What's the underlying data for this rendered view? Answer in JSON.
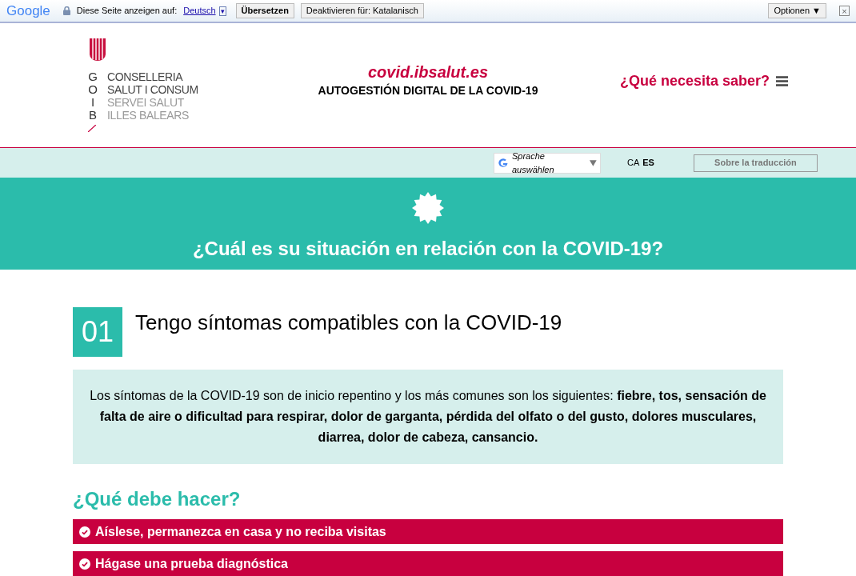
{
  "translate_bar": {
    "brand": "Google",
    "prompt": "Diese Seite anzeigen auf:",
    "language": "Deutsch",
    "dropdown_glyph": "▾",
    "translate_button": "Übersetzen",
    "disable_button": "Deaktivieren für: Katalanisch",
    "options_button": "Optionen ▼",
    "close_glyph": "×"
  },
  "header": {
    "logo_letters": [
      "G",
      "O",
      "I",
      "B"
    ],
    "logo_lines": [
      {
        "text": "CONSELLERIA",
        "kind": "dark"
      },
      {
        "text": "SALUT I CONSUM",
        "kind": "dark"
      },
      {
        "text": "SERVEI SALUT",
        "kind": "light"
      },
      {
        "text": "ILLES BALEARS",
        "kind": "light"
      }
    ],
    "site": "covid.ibsalut.es",
    "subtitle": "AUTOGESTIÓN DIGITAL DE LA COVID-19",
    "menu_label": "¿Qué necesita saber?"
  },
  "language_bar": {
    "selector": "Sprache auswählen",
    "languages": [
      {
        "label": "CA",
        "selected": false
      },
      {
        "label": "ES",
        "selected": true
      }
    ],
    "about_button": "Sobre la traducción"
  },
  "banner": {
    "title": "¿Cuál es su situación en relación con la COVID-19?"
  },
  "section": {
    "number": "01",
    "title": "Tengo síntomas compatibles con la COVID-19",
    "info": "Los síntomas de la COVID-19 son de inicio repentino y los más comunes son los siguientes:  **fiebre, tos, sensación de falta de aire o dificultad para respirar, dolor de garganta, pérdida del olfato o del gusto, dolores musculares, diarrea, dolor de cabeza, cansancio.**",
    "subheading": "¿Qué debe hacer?",
    "actions": [
      "Aíslese, permanezca en casa y no reciba visitas",
      "Hágase una prueba diagnóstica"
    ]
  }
}
